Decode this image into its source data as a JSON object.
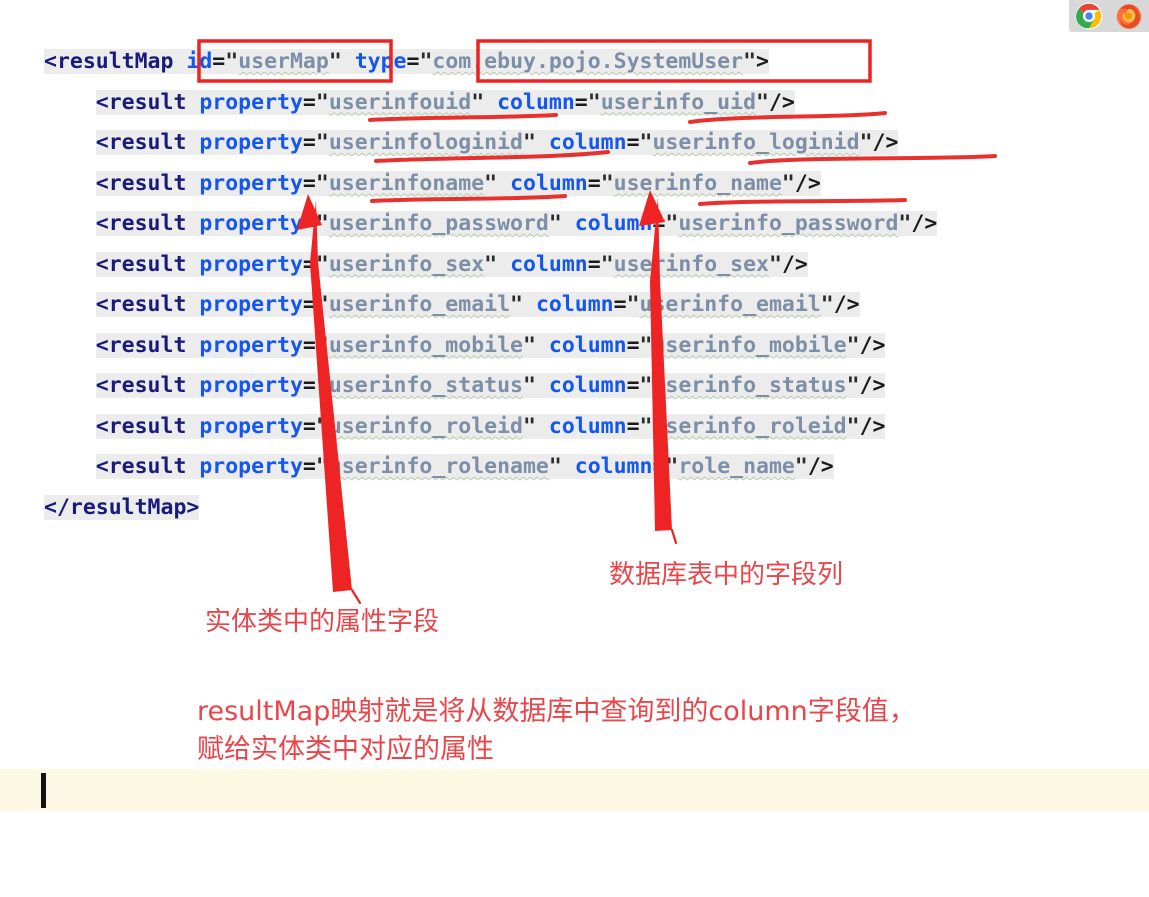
{
  "tray": {
    "icons": [
      {
        "name": "chrome-icon",
        "label": "Google Chrome"
      },
      {
        "name": "firefox-icon",
        "label": "Mozilla Firefox"
      }
    ],
    "background": "#d8d8d8"
  },
  "code": {
    "language": "xml",
    "highlight_color": "#ececec",
    "tag_color": "#1a1a7a",
    "attribute_color": "#1456f0",
    "value_color": "#7d8fa6",
    "lines": [
      {
        "indent": "",
        "tag_open": "<resultMap",
        "attrs": [
          {
            "name": "id",
            "value": "userMap"
          },
          {
            "name": "type",
            "value": "com.ebuy.pojo.SystemUser"
          }
        ],
        "tag_close": ">"
      },
      {
        "indent": "    ",
        "tag_open": "<result",
        "attrs": [
          {
            "name": "property",
            "value": "userinfouid"
          },
          {
            "name": "column",
            "value": "userinfo_uid"
          }
        ],
        "tag_close": "/>"
      },
      {
        "indent": "    ",
        "tag_open": "<result",
        "attrs": [
          {
            "name": "property",
            "value": "userinfologinid"
          },
          {
            "name": "column",
            "value": "userinfo_loginid"
          }
        ],
        "tag_close": "/>"
      },
      {
        "indent": "    ",
        "tag_open": "<result",
        "attrs": [
          {
            "name": "property",
            "value": "userinfoname"
          },
          {
            "name": "column",
            "value": "userinfo_name"
          }
        ],
        "tag_close": "/>"
      },
      {
        "indent": "    ",
        "tag_open": "<result",
        "attrs": [
          {
            "name": "property",
            "value": "userinfo_password"
          },
          {
            "name": "column",
            "value": "userinfo_password"
          }
        ],
        "tag_close": "/>"
      },
      {
        "indent": "    ",
        "tag_open": "<result",
        "attrs": [
          {
            "name": "property",
            "value": "userinfo_sex"
          },
          {
            "name": "column",
            "value": "userinfo_sex"
          }
        ],
        "tag_close": "/>"
      },
      {
        "indent": "    ",
        "tag_open": "<result",
        "attrs": [
          {
            "name": "property",
            "value": "userinfo_email"
          },
          {
            "name": "column",
            "value": "userinfo_email"
          }
        ],
        "tag_close": "/>"
      },
      {
        "indent": "    ",
        "tag_open": "<result",
        "attrs": [
          {
            "name": "property",
            "value": "userinfo_mobile"
          },
          {
            "name": "column",
            "value": "userinfo_mobile"
          }
        ],
        "tag_close": "/>"
      },
      {
        "indent": "    ",
        "tag_open": "<result",
        "attrs": [
          {
            "name": "property",
            "value": "userinfo_status"
          },
          {
            "name": "column",
            "value": "userinfo_status"
          }
        ],
        "tag_close": "/>"
      },
      {
        "indent": "    ",
        "tag_open": "<result",
        "attrs": [
          {
            "name": "property",
            "value": "userinfo_roleid"
          },
          {
            "name": "column",
            "value": "userinfo_roleid"
          }
        ],
        "tag_close": "/>"
      },
      {
        "indent": "    ",
        "tag_open": "<result",
        "attrs": [
          {
            "name": "property",
            "value": "userinfo_rolename"
          },
          {
            "name": "column",
            "value": "role_name"
          }
        ],
        "tag_close": "/>"
      },
      {
        "indent": "",
        "tag_open": "</resultMap>",
        "attrs": [],
        "tag_close": ""
      }
    ]
  },
  "annotations": {
    "color": "#e8464a",
    "label_left": "实体类中的属性字段",
    "label_right": "数据库表中的字段列",
    "summary_line1": "resultMap映射就是将从数据库中查询到的column字段值，",
    "summary_line2": "赋给实体类中对应的属性",
    "boxed": [
      "id=\"userMap\"",
      "type=\"com.ebuy.pojo.SystemUser\""
    ],
    "underlined_property_values": [
      "userinfouid",
      "userinfologinid",
      "userinfoname"
    ],
    "underlined_column_values": [
      "userinfo_uid",
      "userinfo_loginid",
      "userinfo_name"
    ]
  },
  "bottom": {
    "band_color": "#fdf8e3",
    "caret_color": "#111111"
  }
}
